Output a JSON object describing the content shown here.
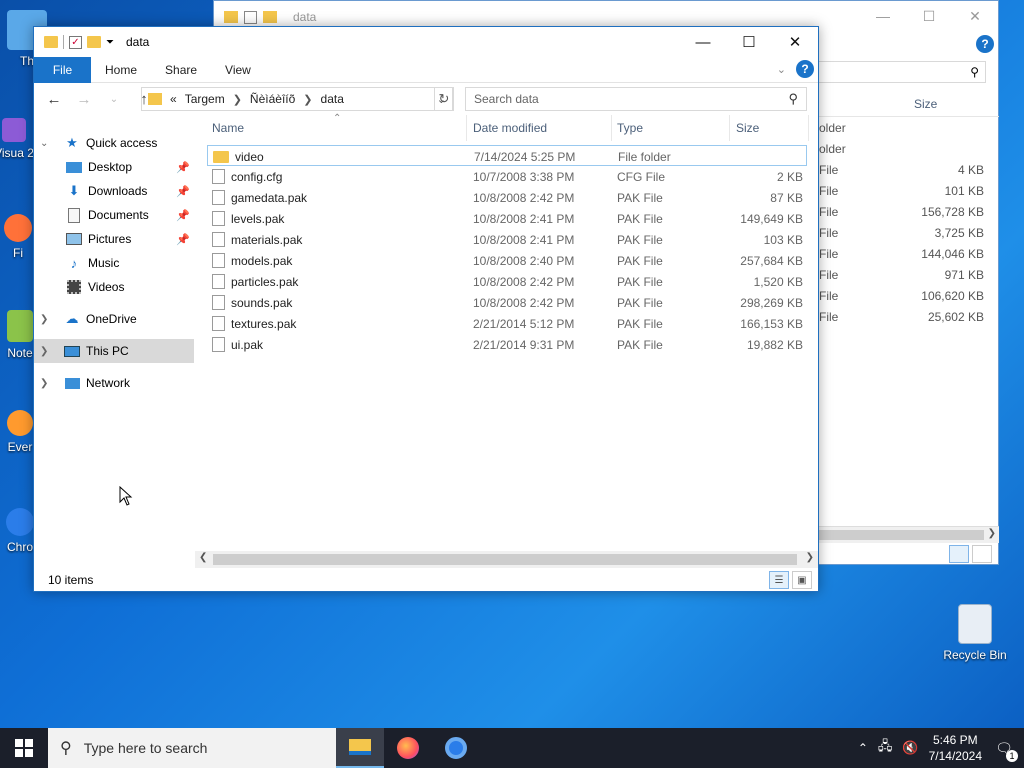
{
  "desktop": {
    "icons": [
      {
        "label": "Th",
        "name": "desktop-icon-this-pc"
      },
      {
        "label": "Visua 2",
        "name": "desktop-icon-visual-studio"
      },
      {
        "label": "Fi",
        "name": "desktop-icon-firefox"
      },
      {
        "label": "Note",
        "name": "desktop-icon-notepad"
      },
      {
        "label": "Ever",
        "name": "desktop-icon-everything"
      },
      {
        "label": "Chro",
        "name": "desktop-icon-chrome"
      }
    ],
    "recycle_bin_label": "Recycle Bin"
  },
  "background_window": {
    "title": "data",
    "size_header": "Size",
    "rows": [
      {
        "type": "older",
        "size": ""
      },
      {
        "type": "older",
        "size": ""
      },
      {
        "type": "File",
        "size": "4 KB"
      },
      {
        "type": "File",
        "size": "101 KB"
      },
      {
        "type": "File",
        "size": "156,728 KB"
      },
      {
        "type": "File",
        "size": "3,725 KB"
      },
      {
        "type": "File",
        "size": "144,046 KB"
      },
      {
        "type": "File",
        "size": "971 KB"
      },
      {
        "type": "File",
        "size": "106,620 KB"
      },
      {
        "type": "File",
        "size": "25,602 KB"
      }
    ]
  },
  "window": {
    "title": "data",
    "ribbon": {
      "file_tab": "File",
      "tabs": [
        "Home",
        "Share",
        "View"
      ]
    },
    "address": {
      "prefix": "«",
      "crumbs": [
        "Targem",
        "Ñèìáèîíõ",
        "data"
      ]
    },
    "search_placeholder": "Search data",
    "sidebar": {
      "quick_access": "Quick access",
      "pinned": [
        {
          "label": "Desktop",
          "icon": "desktop-icon"
        },
        {
          "label": "Downloads",
          "icon": "downloads-icon"
        },
        {
          "label": "Documents",
          "icon": "documents-icon"
        },
        {
          "label": "Pictures",
          "icon": "pictures-icon"
        }
      ],
      "unpinned": [
        {
          "label": "Music",
          "icon": "music-icon"
        },
        {
          "label": "Videos",
          "icon": "videos-icon"
        }
      ],
      "onedrive": "OneDrive",
      "this_pc": "This PC",
      "network": "Network"
    },
    "columns": {
      "name": "Name",
      "date": "Date modified",
      "type": "Type",
      "size": "Size"
    },
    "files": [
      {
        "name": "video",
        "date": "7/14/2024 5:25 PM",
        "type": "File folder",
        "size": "",
        "kind": "folder"
      },
      {
        "name": "config.cfg",
        "date": "10/7/2008 3:38 PM",
        "type": "CFG File",
        "size": "2 KB",
        "kind": "file"
      },
      {
        "name": "gamedata.pak",
        "date": "10/8/2008 2:42 PM",
        "type": "PAK File",
        "size": "87 KB",
        "kind": "file"
      },
      {
        "name": "levels.pak",
        "date": "10/8/2008 2:41 PM",
        "type": "PAK File",
        "size": "149,649 KB",
        "kind": "file"
      },
      {
        "name": "materials.pak",
        "date": "10/8/2008 2:41 PM",
        "type": "PAK File",
        "size": "103 KB",
        "kind": "file"
      },
      {
        "name": "models.pak",
        "date": "10/8/2008 2:40 PM",
        "type": "PAK File",
        "size": "257,684 KB",
        "kind": "file"
      },
      {
        "name": "particles.pak",
        "date": "10/8/2008 2:42 PM",
        "type": "PAK File",
        "size": "1,520 KB",
        "kind": "file"
      },
      {
        "name": "sounds.pak",
        "date": "10/8/2008 2:42 PM",
        "type": "PAK File",
        "size": "298,269 KB",
        "kind": "file"
      },
      {
        "name": "textures.pak",
        "date": "2/21/2014 5:12 PM",
        "type": "PAK File",
        "size": "166,153 KB",
        "kind": "file"
      },
      {
        "name": "ui.pak",
        "date": "2/21/2014 9:31 PM",
        "type": "PAK File",
        "size": "19,882 KB",
        "kind": "file"
      }
    ],
    "status": "10 items"
  },
  "taskbar": {
    "search_placeholder": "Type here to search",
    "time": "5:46 PM",
    "date": "7/14/2024",
    "notification_count": "1"
  },
  "colors": {
    "accent": "#1a73c9",
    "folder": "#f4c64c",
    "selection_border": "#99c9ef",
    "taskbar": "#1b1f2a"
  }
}
